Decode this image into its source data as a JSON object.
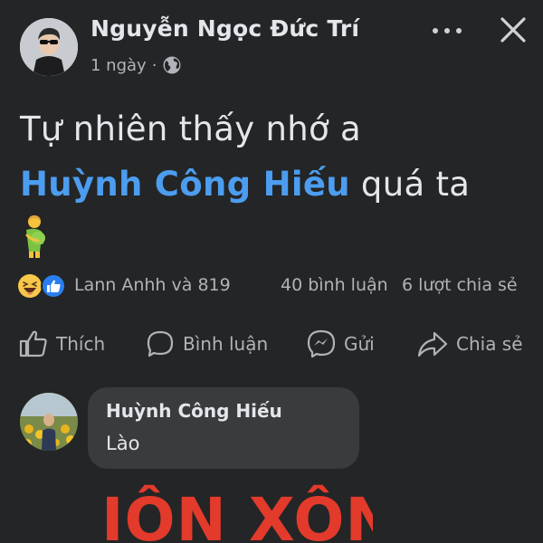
{
  "post": {
    "author": "Nguyễn Ngọc Đức Trí",
    "time": "1 ngày",
    "separator": "·",
    "privacy_icon": "globe-icon",
    "text_line1": "Tự nhiên thấy nhớ a",
    "mention": "Huỳnh Công Hiếu",
    "text_after_mention": " quá ta",
    "emoji": "pregnant-man-emoji"
  },
  "header": {
    "more_icon": "more-icon",
    "close_icon": "close-icon"
  },
  "stats": {
    "reaction_icons": [
      "haha-icon",
      "like-icon"
    ],
    "reactions_text": "Lann Anhh và 819",
    "comments": "40 bình luận",
    "shares": "6 lượt chia sẻ"
  },
  "actions": {
    "like": "Thích",
    "comment": "Bình luận",
    "send": "Gửi",
    "share": "Chia sẻ"
  },
  "comment": {
    "author": "Huỳnh Công Hiếu",
    "text": "Lào",
    "sticker_text": "IÔN XÔN"
  },
  "colors": {
    "background": "#242526",
    "text": "#e4e6eb",
    "secondary": "#b0b3b8",
    "mention": "#4c9df0",
    "bubble": "#3a3b3c",
    "sticker": "#e23a2b"
  }
}
